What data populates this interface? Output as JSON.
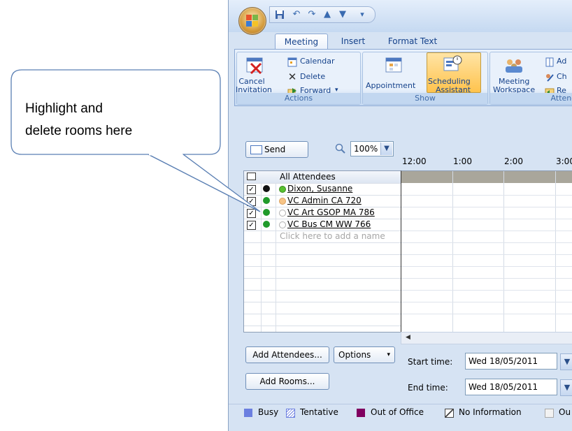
{
  "callout": {
    "line1": "Highlight and",
    "line2": "delete rooms here"
  },
  "tabs": [
    "Meeting",
    "Insert",
    "Format Text"
  ],
  "ribbon": {
    "actions": {
      "cancel_line1": "Cancel",
      "cancel_line2": "Invitation",
      "calendar": "Calendar",
      "delete": "Delete",
      "forward": "Forward",
      "label": "Actions"
    },
    "show": {
      "appointment": "Appointment",
      "sched_line1": "Scheduling",
      "sched_line2": "Assistant",
      "label": "Show"
    },
    "attendees": {
      "workspace_line1": "Meeting",
      "workspace_line2": "Workspace",
      "ad": "Ad",
      "ch": "Ch",
      "re": "Re",
      "label": "Attende"
    }
  },
  "toolbar": {
    "send": "Send",
    "zoom": "100%"
  },
  "times": [
    "12:00",
    "1:00",
    "2:00",
    "3:00"
  ],
  "attendees": {
    "header": "All Attendees",
    "rows": [
      {
        "name": "Dixon, Susanne"
      },
      {
        "name": "VC Admin CA 720"
      },
      {
        "name": "VC Art GSOP MA 786"
      },
      {
        "name": "VC Bus CM WW 766"
      }
    ],
    "add_placeholder": "Click here to add a name"
  },
  "buttons": {
    "add_attendees": "Add Attendees...",
    "options": "Options",
    "add_rooms": "Add Rooms..."
  },
  "fields": {
    "start_label": "Start time:",
    "start_value": "Wed 18/05/2011",
    "end_label": "End time:",
    "end_value": "Wed 18/05/2011"
  },
  "legend": {
    "busy": "Busy",
    "tentative": "Tentative",
    "ooo": "Out of Office",
    "noinfo": "No Information",
    "ou": "Ou"
  },
  "colors": {
    "busy": "#6b7fe0",
    "ooo": "#800060",
    "accent": "#15428b"
  }
}
